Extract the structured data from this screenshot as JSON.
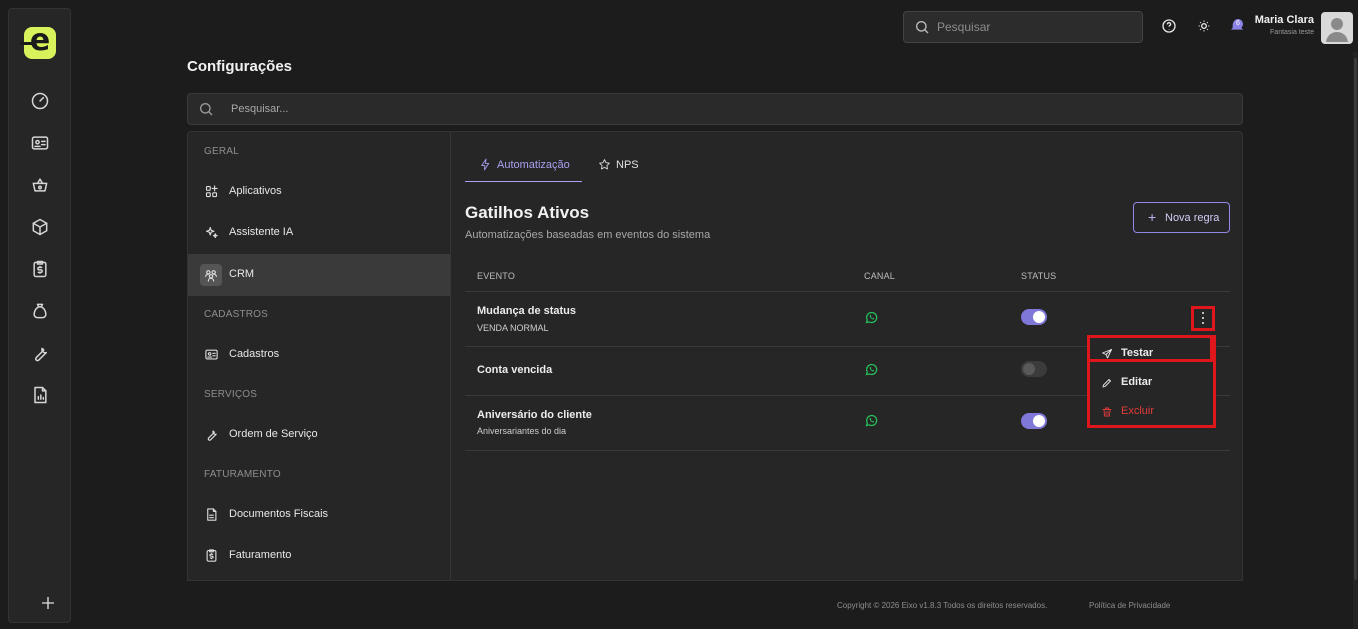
{
  "app": {
    "logo_letter": "e",
    "brand_color": "#d7f25a",
    "accent_color": "#8f88e8",
    "danger_color": "#e23b3b"
  },
  "rail": {
    "icons": [
      "dashboard-icon",
      "id-card-icon",
      "basket-icon",
      "box-icon",
      "receipt-icon",
      "money-bag-icon",
      "wrench-icon",
      "report-icon"
    ],
    "add_icon": "plus-icon"
  },
  "topbar": {
    "search_placeholder": "Pesquisar",
    "notification_badge": "6",
    "user_name": "Maria Clara",
    "user_company": "Fantasia teste"
  },
  "page": {
    "title": "Configurações",
    "search_placeholder": "Pesquisar..."
  },
  "nav": {
    "sections": [
      {
        "label": "GERAL",
        "items": [
          {
            "label": "Aplicativos",
            "icon": "apps-icon"
          },
          {
            "label": "Assistente IA",
            "icon": "sparkles-icon"
          },
          {
            "label": "CRM",
            "icon": "users-icon",
            "active": true
          }
        ]
      },
      {
        "label": "CADASTROS",
        "items": [
          {
            "label": "Cadastros",
            "icon": "id-card-icon"
          }
        ]
      },
      {
        "label": "SERVIÇOS",
        "items": [
          {
            "label": "Ordem de Serviço",
            "icon": "wrench-icon"
          }
        ]
      },
      {
        "label": "FATURAMENTO",
        "items": [
          {
            "label": "Documentos Fiscais",
            "icon": "document-icon"
          },
          {
            "label": "Faturamento",
            "icon": "receipt-icon"
          }
        ]
      }
    ]
  },
  "tabs": [
    {
      "label": "Automatização",
      "icon": "lightning-icon",
      "active": true
    },
    {
      "label": "NPS",
      "icon": "star-icon"
    }
  ],
  "triggers": {
    "title": "Gatilhos Ativos",
    "subtitle": "Automatizações baseadas em eventos do sistema",
    "new_rule_label": "Nova regra",
    "columns": [
      "EVENTO",
      "CANAL",
      "STATUS"
    ],
    "rows": [
      {
        "event": "Mudança de status",
        "detail": "VENDA NORMAL",
        "channel": "whatsapp-icon",
        "status": true
      },
      {
        "event": "Conta vencida",
        "detail": "",
        "channel": "whatsapp-icon",
        "status": false
      },
      {
        "event": "Aniversário do cliente",
        "detail": "Aniversariantes do dia",
        "channel": "whatsapp-icon",
        "status": true
      }
    ]
  },
  "row_menu": {
    "items": [
      {
        "label": "Testar",
        "icon": "send-icon"
      },
      {
        "label": "Editar",
        "icon": "pencil-icon"
      },
      {
        "label": "Excluir",
        "icon": "trash-icon",
        "danger": true
      }
    ]
  },
  "footer": {
    "copyright": "Copyright © 2026 Eixo v1.8.3 Todos os direitos reservados.",
    "privacy": "Política de Privacidade"
  }
}
